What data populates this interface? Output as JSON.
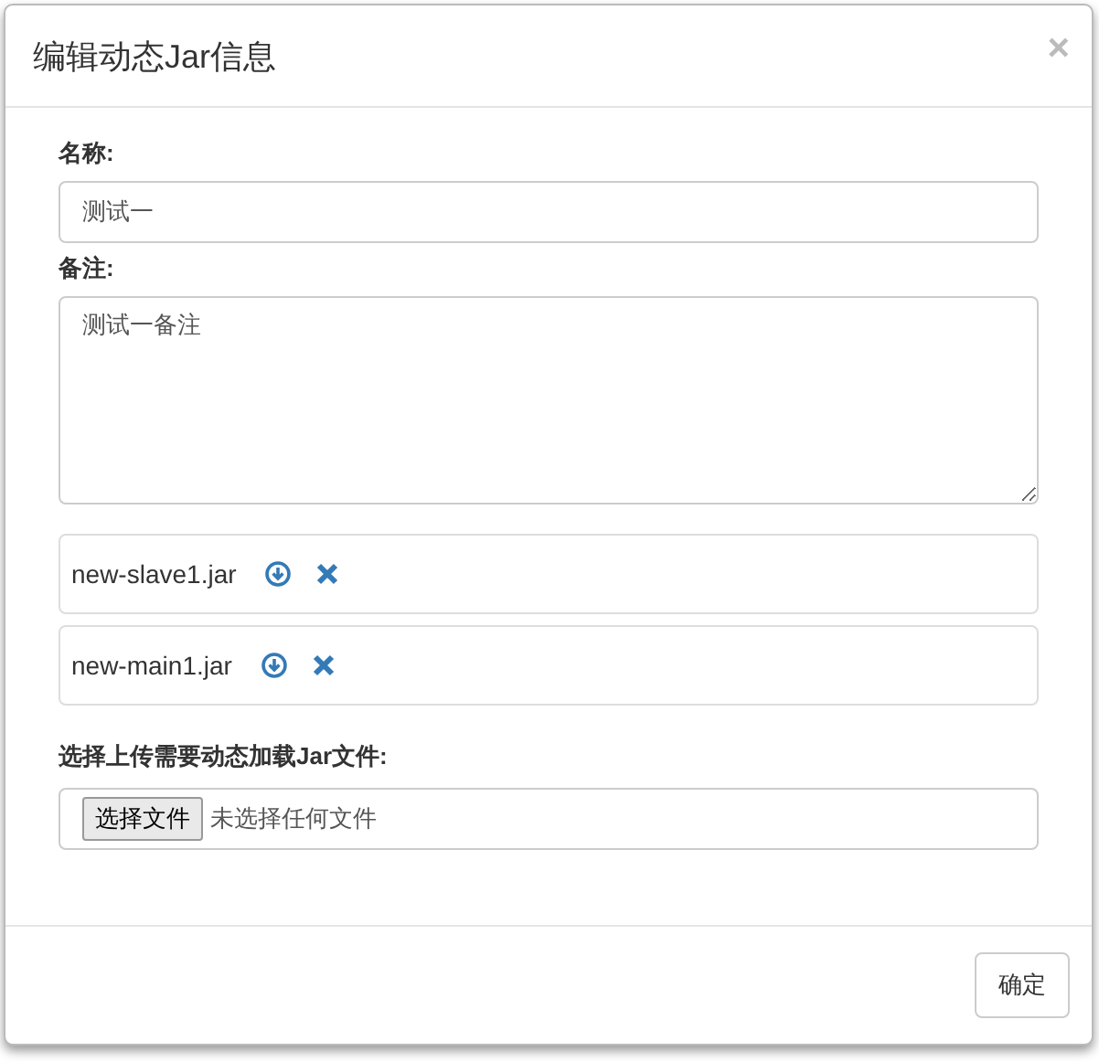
{
  "dialog": {
    "title": "编辑动态Jar信息",
    "close": "×"
  },
  "name_field": {
    "label": "名称:",
    "value": "测试一"
  },
  "note_field": {
    "label": "备注:",
    "value": "测试一备注"
  },
  "files": [
    {
      "name": "new-slave1.jar"
    },
    {
      "name": "new-main1.jar"
    }
  ],
  "upload": {
    "label": "选择上传需要动态加载Jar文件:",
    "button": "选择文件",
    "status": "未选择任何文件"
  },
  "footer": {
    "button": "确定"
  }
}
